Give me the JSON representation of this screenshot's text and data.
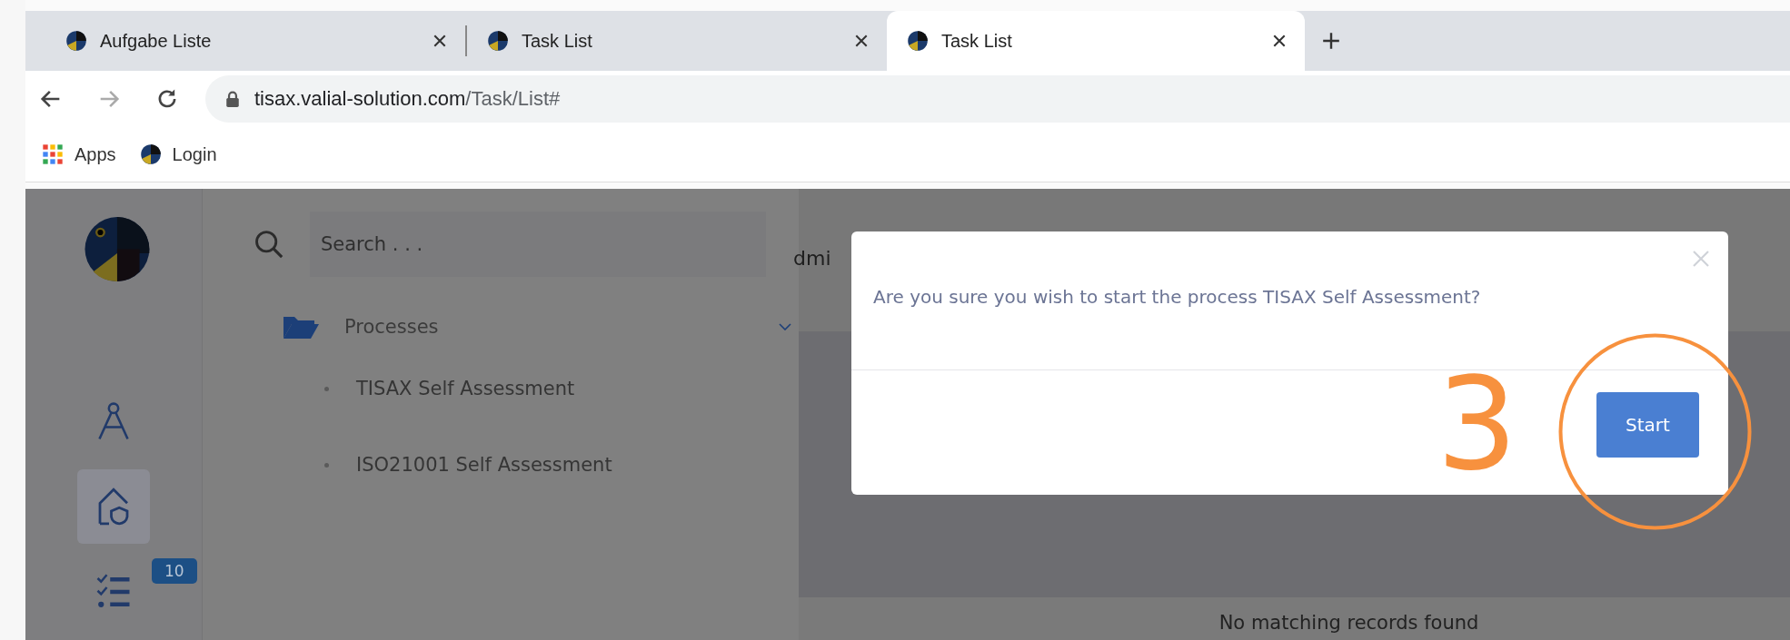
{
  "browser": {
    "tabs": [
      {
        "title": "Aufgabe Liste",
        "selected": false
      },
      {
        "title": "Task List",
        "selected": false
      },
      {
        "title": "Task List",
        "selected": true
      }
    ],
    "url": {
      "host": "tisax.valial-solution.com",
      "path": "/Task/List#"
    },
    "bookmarks": [
      {
        "kind": "apps",
        "label": "Apps"
      },
      {
        "kind": "site",
        "label": "Login"
      }
    ]
  },
  "sidebar": {
    "items": [
      {
        "kind": "compass",
        "selected": false
      },
      {
        "kind": "home",
        "selected": true
      },
      {
        "kind": "tasks",
        "selected": false,
        "badge": "10"
      }
    ]
  },
  "nav": {
    "search": {
      "placeholder": "Search . . ."
    },
    "group": {
      "label": "Processes",
      "expanded": true,
      "children": [
        {
          "label": "TISAX Self Assessment"
        },
        {
          "label": "ISO21001 Self Assessment"
        }
      ]
    }
  },
  "main": {
    "heading": "dmi",
    "empty_message": "No matching records found"
  },
  "dialog": {
    "message": "Are you sure you wish to start the process TISAX Self Assessment?",
    "buttons": [
      {
        "label": "Start"
      }
    ]
  },
  "annotation": {
    "label": "3"
  }
}
